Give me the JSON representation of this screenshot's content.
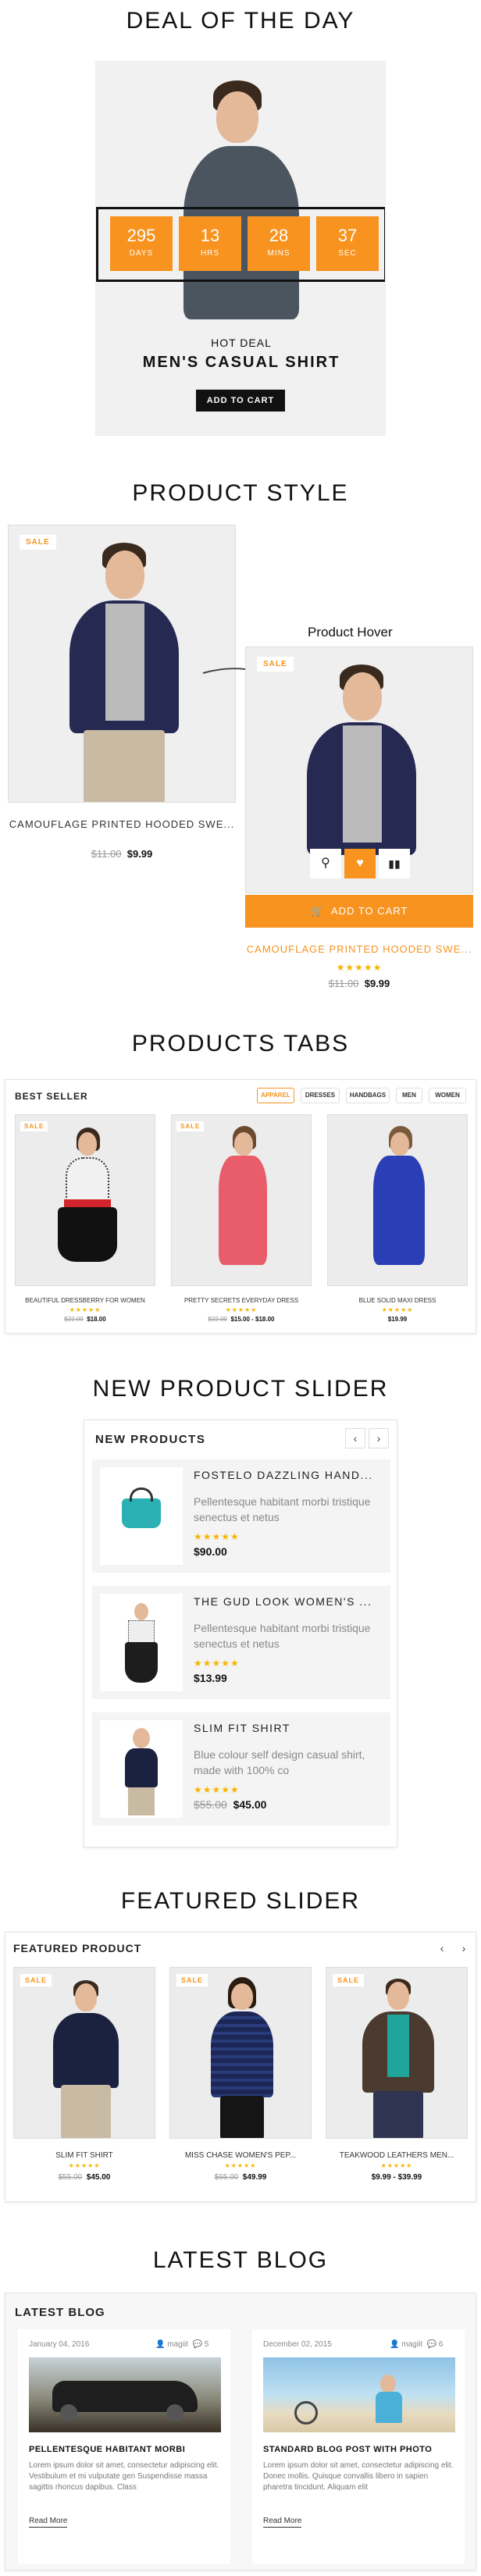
{
  "colors": {
    "accent": "#f7931e",
    "dark": "#111111",
    "gray_bg": "#f4f4f4",
    "star": "#f7b500"
  },
  "deal": {
    "section_title": "DEAL OF THE DAY",
    "countdown": [
      {
        "value": "295",
        "label": "DAYS"
      },
      {
        "value": "13",
        "label": "HRS"
      },
      {
        "value": "28",
        "label": "MINS"
      },
      {
        "value": "37",
        "label": "SEC"
      }
    ],
    "tag": "HOT DEAL",
    "name": "MEN'S CASUAL SHIRT",
    "button": "ADD TO CART"
  },
  "product_style": {
    "section_title": "PRODUCT STYLE",
    "sale_badge": "SALE",
    "product_name": "CAMOUFLAGE PRINTED HOODED SWE...",
    "old_price": "$11.00",
    "price": "$9.99",
    "hover_label": "Product Hover",
    "hover_sale_badge": "SALE",
    "hover_add_to_cart": "ADD TO CART",
    "hover_product_name": "CAMOUFLAGE PRINTED HOODED SWE...",
    "hover_old_price": "$11.00",
    "hover_price": "$9.99",
    "hover_icons": [
      "search-icon",
      "heart-icon",
      "compare-icon",
      "cart-icon"
    ]
  },
  "tabs": {
    "section_title": "PRODUCTS TABS",
    "block_title": "BEST SELLER",
    "tab_items": [
      "APPAREL",
      "DRESSES",
      "HANDBAGS",
      "MEN",
      "WOMEN"
    ],
    "active_tab": "APPAREL",
    "products": [
      {
        "badge": "SALE",
        "name": "BEAUTIFUL DRESSBERRY FOR WOMEN",
        "old_price": "$22.00",
        "price": "$18.00"
      },
      {
        "badge": "SALE",
        "name": "PRETTY SECRETS EVERYDAY DRESS",
        "old_price": "$22.00",
        "price": "$15.00 - $18.00"
      },
      {
        "badge": "",
        "name": "BLUE SOLID MAXI DRESS",
        "old_price": "",
        "price": "$19.99"
      }
    ]
  },
  "new_slider": {
    "section_title": "NEW PRODUCT SLIDER",
    "block_title": "NEW PRODUCTS",
    "items": [
      {
        "name": "FOSTELO DAZZLING HAND...",
        "desc": "Pellentesque habitant morbi tristique senectus et netus",
        "old_price": "",
        "price": "$90.00"
      },
      {
        "name": "THE GUD LOOK WOMEN'S ...",
        "desc": "Pellentesque habitant morbi tristique senectus et netus",
        "old_price": "",
        "price": "$13.99"
      },
      {
        "name": "SLIM FIT SHIRT",
        "desc": "Blue colour self design casual shirt, made with 100% co",
        "old_price": "$55.00",
        "price": "$45.00"
      }
    ]
  },
  "featured": {
    "section_title": "FEATURED SLIDER",
    "block_title": "FEATURED PRODUCT",
    "products": [
      {
        "badge": "SALE",
        "name": "SLIM FIT SHIRT",
        "old_price": "$55.00",
        "price": "$45.00"
      },
      {
        "badge": "SALE",
        "name": "MISS CHASE WOMEN'S PEP...",
        "old_price": "$65.00",
        "price": "$49.99"
      },
      {
        "badge": "SALE",
        "name": "TEAKWOOD LEATHERS MEN...",
        "old_price": "",
        "price": "$9.99 - $39.99"
      }
    ]
  },
  "blog": {
    "section_title": "LATEST BLOG",
    "block_title": "LATEST BLOG",
    "posts": [
      {
        "date": "January 04, 2016",
        "author": "magiit",
        "comments": "5",
        "title": "PELLENTESQUE HABITANT MORBI",
        "excerpt": "Lorem ipsum dolor sit amet, consectetur adipiscing elit. Vestibulum et mi vulputate gen Suspendisse massa sagittis rhoncus dapibus. Class",
        "read_more": "Read More"
      },
      {
        "date": "December 02, 2015",
        "author": "magiit",
        "comments": "6",
        "title": "STANDARD BLOG POST WITH PHOTO",
        "excerpt": "Lorem ipsum dolor sit amet, consectetur adipiscing elit. Donec mollis. Quisque convallis libero in sapien pharetra tincidunt. Aliquam elit",
        "read_more": "Read More"
      }
    ]
  }
}
